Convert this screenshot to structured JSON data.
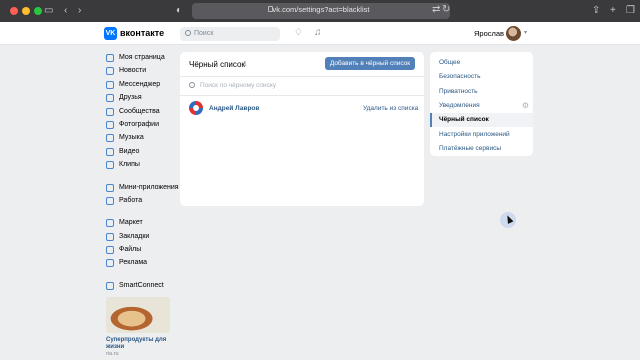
{
  "browser": {
    "url": "vk.com/settings?act=blacklist"
  },
  "header": {
    "brand": "вконтакте",
    "logo_text": "VK",
    "search_placeholder": "Поиск",
    "user_name": "Ярослав"
  },
  "nav": {
    "group1": [
      {
        "label": "Моя страница",
        "icon": "home-icon"
      },
      {
        "label": "Новости",
        "icon": "news-icon"
      },
      {
        "label": "Мессенджер",
        "icon": "messenger-icon"
      },
      {
        "label": "Друзья",
        "icon": "friends-icon"
      },
      {
        "label": "Сообщества",
        "icon": "communities-icon"
      },
      {
        "label": "Фотографии",
        "icon": "photos-icon"
      },
      {
        "label": "Музыка",
        "icon": "music-icon"
      },
      {
        "label": "Видео",
        "icon": "video-icon"
      },
      {
        "label": "Клипы",
        "icon": "clips-icon"
      }
    ],
    "group2": [
      {
        "label": "Мини-приложения",
        "icon": "apps-icon"
      },
      {
        "label": "Работа",
        "icon": "work-icon"
      }
    ],
    "group3": [
      {
        "label": "Маркет",
        "icon": "market-icon"
      },
      {
        "label": "Закладки",
        "icon": "bookmarks-icon"
      },
      {
        "label": "Файлы",
        "icon": "files-icon"
      },
      {
        "label": "Реклама",
        "icon": "ads-icon"
      }
    ],
    "group4": [
      {
        "label": "SmartConnect",
        "icon": "smartconnect-icon"
      }
    ],
    "promo": {
      "title": "Суперпродукты для жизни",
      "source": "ria.ru"
    }
  },
  "blacklist": {
    "title": "Чёрный список",
    "count": "1",
    "add_button": "Добавить в чёрный список",
    "search_placeholder": "Поиск по чёрному списку",
    "entries": [
      {
        "name": "Андрей Лавров",
        "action": "Удалить из списка"
      }
    ]
  },
  "settings_menu": {
    "items": [
      {
        "label": "Общее",
        "active": false
      },
      {
        "label": "Безопасность",
        "active": false
      },
      {
        "label": "Приватность",
        "active": false
      },
      {
        "label": "Уведомления",
        "active": false
      },
      {
        "label": "Чёрный список",
        "active": true
      },
      {
        "label": "Настройки приложений",
        "active": false
      },
      {
        "label": "Платёжные сервисы",
        "active": false
      }
    ]
  }
}
